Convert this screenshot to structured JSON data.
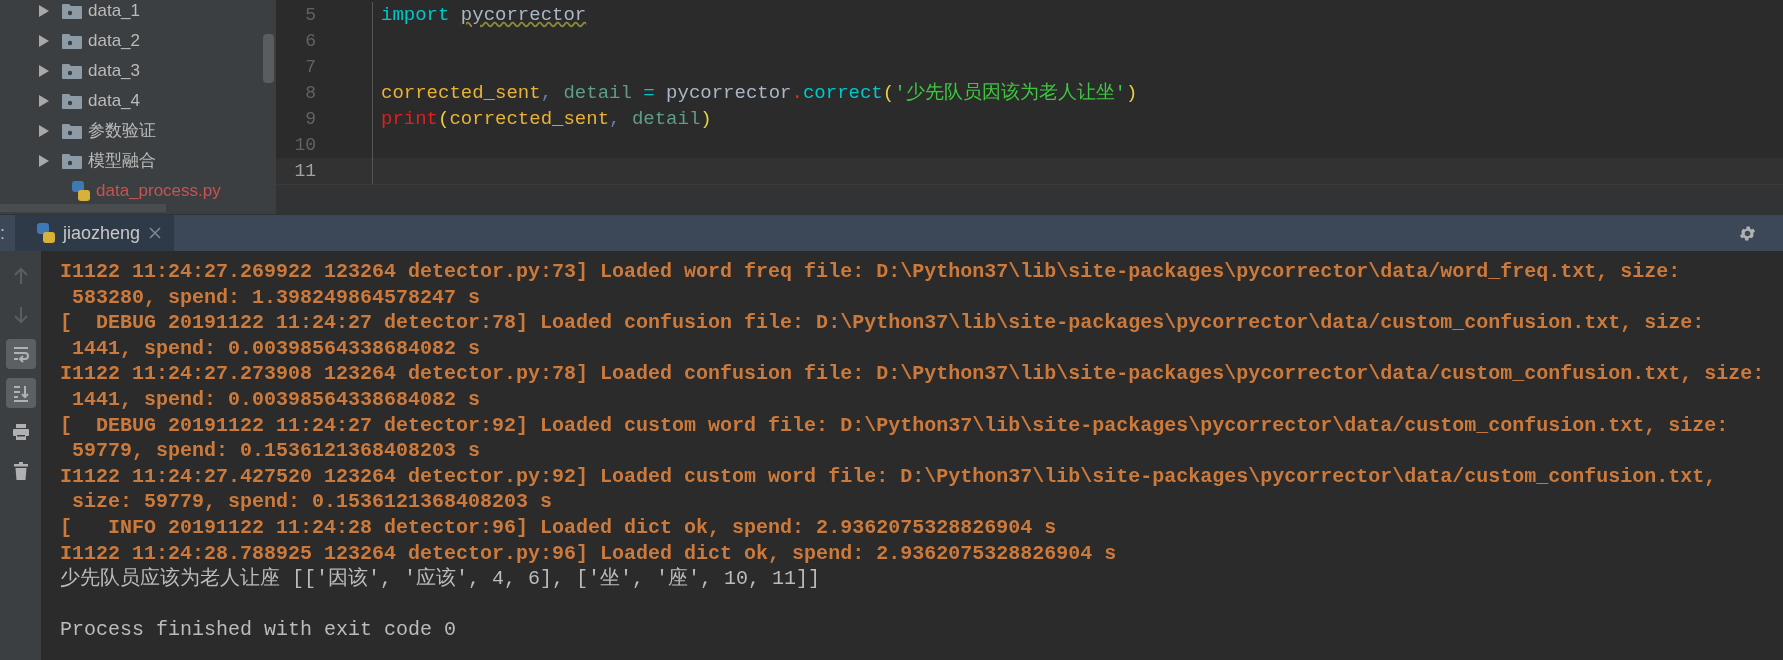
{
  "project_tree": {
    "items": [
      {
        "label": "data_1",
        "kind": "folder",
        "expanded": false
      },
      {
        "label": "data_2",
        "kind": "folder",
        "expanded": false
      },
      {
        "label": "data_3",
        "kind": "folder",
        "expanded": false
      },
      {
        "label": "data_4",
        "kind": "folder",
        "expanded": false
      },
      {
        "label": "参数验证",
        "kind": "folder",
        "expanded": false
      },
      {
        "label": "模型融合",
        "kind": "folder",
        "expanded": false
      },
      {
        "label": "data_process.py",
        "kind": "python_file"
      }
    ]
  },
  "editor": {
    "lines": [
      {
        "number": "5",
        "current": false,
        "tokens": [
          {
            "text": "import ",
            "kind": "keyword"
          },
          {
            "text": "pycorrector",
            "kind": "unresolved"
          }
        ]
      },
      {
        "number": "6",
        "current": false
      },
      {
        "number": "7",
        "current": false
      },
      {
        "number": "8",
        "current": false,
        "tokens": [
          {
            "text": "corrected_sent",
            "kind": "variable"
          },
          {
            "text": ", ",
            "kind": "punct"
          },
          {
            "text": "detail",
            "kind": "variable2"
          },
          {
            "text": " = ",
            "kind": "operator"
          },
          {
            "text": "pycorrector",
            "kind": "plain"
          },
          {
            "text": ".",
            "kind": "dot"
          },
          {
            "text": "correct",
            "kind": "keyword"
          },
          {
            "text": "(",
            "kind": "paren"
          },
          {
            "text": "'少先队员因该为老人让坐'",
            "kind": "string"
          },
          {
            "text": ")",
            "kind": "paren"
          }
        ]
      },
      {
        "number": "9",
        "current": false,
        "tokens": [
          {
            "text": "print",
            "kind": "builtin"
          },
          {
            "text": "(",
            "kind": "paren"
          },
          {
            "text": "corrected_sent",
            "kind": "variable"
          },
          {
            "text": ", ",
            "kind": "punct"
          },
          {
            "text": "detail",
            "kind": "variable2"
          },
          {
            "text": ")",
            "kind": "paren"
          }
        ]
      },
      {
        "number": "10",
        "current": false
      },
      {
        "number": "11",
        "current": true
      }
    ]
  },
  "run_panel": {
    "label": ":",
    "tabs": [
      {
        "label": "jiaozheng",
        "selected": true
      }
    ],
    "toolbar": [
      {
        "kind": "up",
        "disabled": true,
        "on": false
      },
      {
        "kind": "down",
        "disabled": true,
        "on": false
      },
      {
        "kind": "wrap",
        "disabled": false,
        "on": true
      },
      {
        "kind": "scroll_end",
        "disabled": false,
        "on": true
      },
      {
        "kind": "print",
        "disabled": false,
        "on": false
      },
      {
        "kind": "trash",
        "disabled": false,
        "on": false
      }
    ],
    "console": [
      {
        "kind": "log",
        "text": "I1122 11:24:27.269922 123264 detector.py:73] Loaded word freq file: D:\\Python37\\lib\\site-packages\\pycorrector\\data/word_freq.txt, size:"
      },
      {
        "kind": "log",
        "text": " 583280, spend: 1.398249864578247 s"
      },
      {
        "kind": "log",
        "text": "[  DEBUG 20191122 11:24:27 detector:78] Loaded confusion file: D:\\Python37\\lib\\site-packages\\pycorrector\\data/custom_confusion.txt, size:"
      },
      {
        "kind": "log",
        "text": " 1441, spend: 0.00398564338684082 s"
      },
      {
        "kind": "log",
        "text": "I1122 11:24:27.273908 123264 detector.py:78] Loaded confusion file: D:\\Python37\\lib\\site-packages\\pycorrector\\data/custom_confusion.txt, size:"
      },
      {
        "kind": "log",
        "text": " 1441, spend: 0.00398564338684082 s"
      },
      {
        "kind": "log",
        "text": "[  DEBUG 20191122 11:24:27 detector:92] Loaded custom word file: D:\\Python37\\lib\\site-packages\\pycorrector\\data/custom_confusion.txt, size:"
      },
      {
        "kind": "log",
        "text": " 59779, spend: 0.1536121368408203 s"
      },
      {
        "kind": "log",
        "text": "I1122 11:24:27.427520 123264 detector.py:92] Loaded custom word file: D:\\Python37\\lib\\site-packages\\pycorrector\\data/custom_confusion.txt,"
      },
      {
        "kind": "log",
        "text": " size: 59779, spend: 0.1536121368408203 s"
      },
      {
        "kind": "log",
        "text": "[   INFO 20191122 11:24:28 detector:96] Loaded dict ok, spend: 2.9362075328826904 s"
      },
      {
        "kind": "log",
        "text": "I1122 11:24:28.788925 123264 detector.py:96] Loaded dict ok, spend: 2.9362075328826904 s"
      },
      {
        "kind": "output",
        "text": "少先队员应该为老人让座 [['因该', '应该', 4, 6], ['坐', '座', 10, 11]]"
      },
      {
        "kind": "blank"
      },
      {
        "kind": "output",
        "text": "Process finished with exit code 0"
      }
    ]
  }
}
